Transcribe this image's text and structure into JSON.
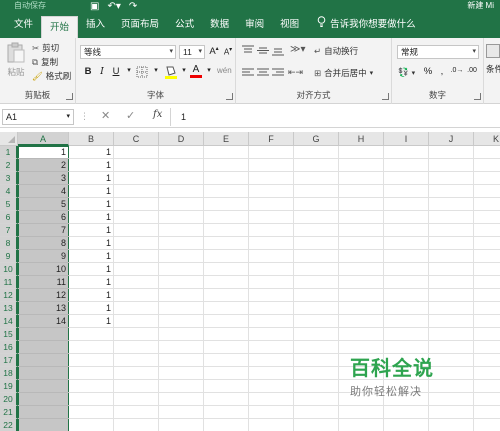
{
  "titlebar": {
    "autosave": "自动保存",
    "doc_title": "新建 Mi"
  },
  "tabs": [
    {
      "label": "文件"
    },
    {
      "label": "开始"
    },
    {
      "label": "插入"
    },
    {
      "label": "页面布局"
    },
    {
      "label": "公式"
    },
    {
      "label": "数据"
    },
    {
      "label": "审阅"
    },
    {
      "label": "视图"
    }
  ],
  "active_tab": "开始",
  "tell_me": "告诉我你想要做什么",
  "clipboard": {
    "paste": "粘贴",
    "cut": "剪切",
    "copy": "复制",
    "format_painter": "格式刷",
    "group": "剪贴板"
  },
  "font": {
    "name": "等线",
    "size": "11",
    "grow": "A",
    "shrink": "A",
    "bold": "B",
    "italic": "I",
    "underline": "U",
    "group": "字体"
  },
  "alignment": {
    "wrap": "自动换行",
    "merge": "合并后居中",
    "group": "对齐方式"
  },
  "number": {
    "format": "常规",
    "percent": "%",
    "comma": ",",
    "group": "数字",
    "cond": "条件格"
  },
  "formula_bar": {
    "name_box": "A1",
    "fx": "fx",
    "content": "1"
  },
  "columns": [
    "A",
    "B",
    "C",
    "D",
    "E",
    "F",
    "G",
    "H",
    "I",
    "J",
    "K"
  ],
  "rows": [
    "1",
    "2",
    "3",
    "4",
    "5",
    "6",
    "7",
    "8",
    "9",
    "10",
    "11",
    "12",
    "13",
    "14",
    "15",
    "16",
    "17",
    "18",
    "19",
    "20",
    "21",
    "22"
  ],
  "col_a": [
    "1",
    "2",
    "3",
    "4",
    "5",
    "6",
    "7",
    "8",
    "9",
    "10",
    "11",
    "12",
    "13",
    "14"
  ],
  "col_b": [
    "1",
    "1",
    "1",
    "1",
    "1",
    "1",
    "1",
    "1",
    "1",
    "1",
    "1",
    "1",
    "1",
    "1"
  ],
  "watermark": {
    "title": "百科全说",
    "subtitle": "助你轻松解决"
  },
  "colors": {
    "accent": "#217346",
    "watermark": "#2ea44f"
  }
}
